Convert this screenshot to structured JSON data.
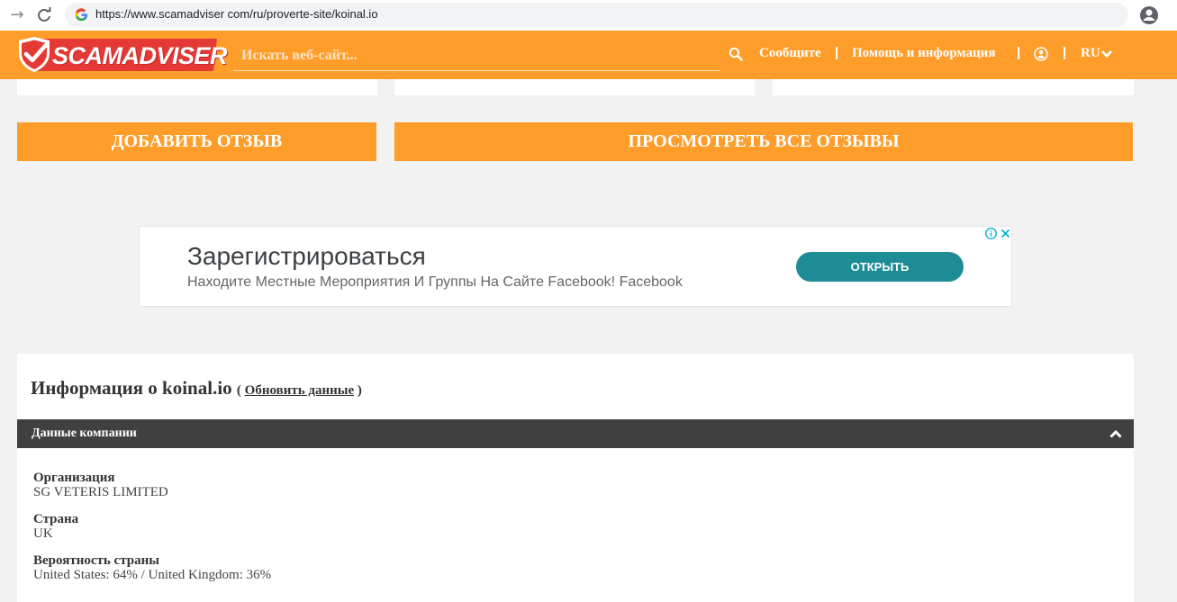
{
  "browser": {
    "url": "https://www.scamadviser com/ru/proverte-site/koinal.io"
  },
  "header": {
    "logo_text": "SCAMADVISER",
    "search_placeholder": "Искать веб-сайт...",
    "nav_report": "Сообщите",
    "nav_help": "Помощь и информация",
    "separator": "|",
    "language": "RU"
  },
  "actions": {
    "add_review": "ДОБАВИТЬ ОТЗЫВ",
    "view_reviews": "ПРОСМОТРЕТЬ ВСЕ ОТЗЫВЫ"
  },
  "ad": {
    "title": "Зарегистрироваться",
    "subtitle": "Находите Местные Мероприятия И Группы На Сайте Facebook! Facebook",
    "button": "ОТКРЫТЬ"
  },
  "info": {
    "title": "Информация о koinal.io",
    "refresh_open": "( ",
    "refresh_link": "Обновить данные",
    "refresh_close": " )",
    "section_title": "Данные компании",
    "fields": [
      {
        "label": "Организация",
        "value": "SG VETERIS LIMITED"
      },
      {
        "label": "Страна",
        "value": "UK"
      },
      {
        "label": "Вероятность страны",
        "value": "United States: 64% / United Kingdom: 36%"
      }
    ]
  },
  "colors": {
    "brand_orange": "#ff9d2a",
    "logo_red": "#e53935",
    "ad_button": "#1e8c94",
    "section_bar": "#404040"
  }
}
